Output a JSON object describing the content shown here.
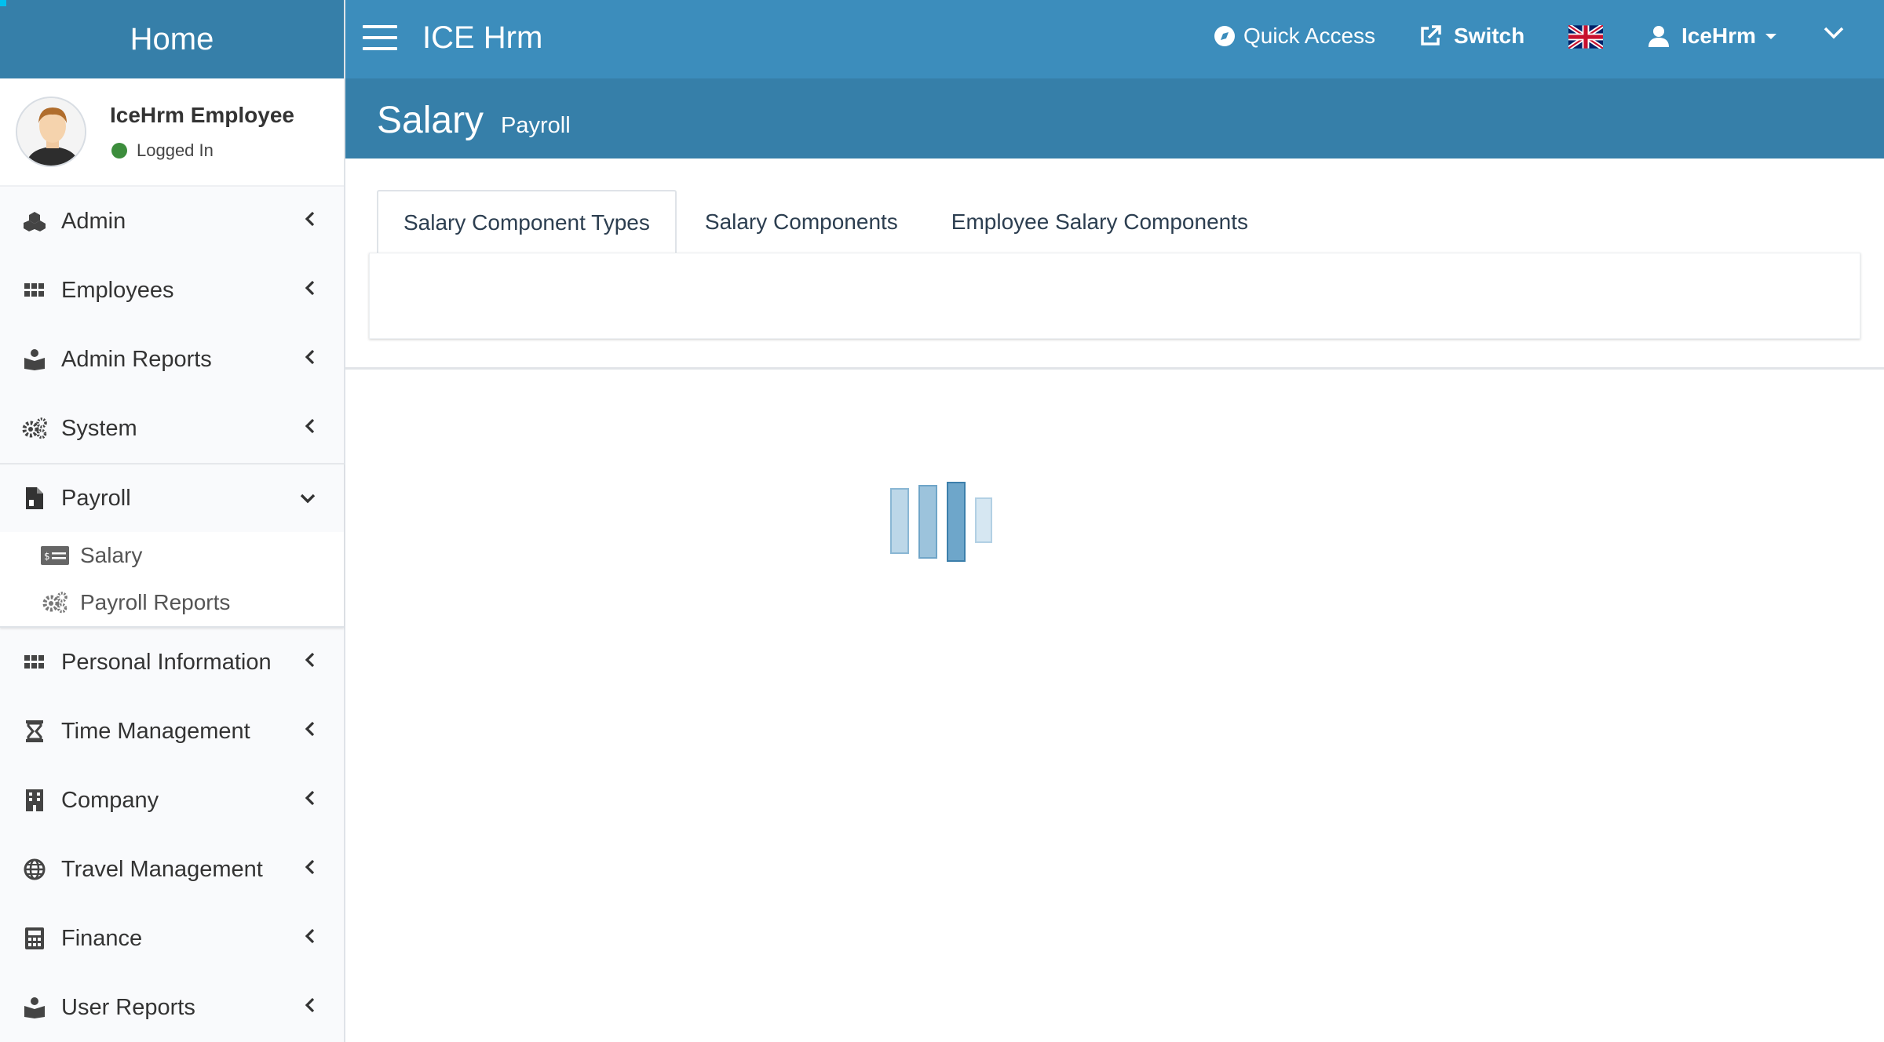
{
  "sidebar": {
    "brand": "Home",
    "user": {
      "name": "IceHrm Employee",
      "status": "Logged In"
    },
    "items": [
      {
        "label": "Admin",
        "icon": "cubes-icon"
      },
      {
        "label": "Employees",
        "icon": "grid-icon"
      },
      {
        "label": "Admin Reports",
        "icon": "book-reader-icon"
      },
      {
        "label": "System",
        "icon": "cogs-icon"
      },
      {
        "label": "Payroll",
        "icon": "file-invoice-icon",
        "expanded": true
      },
      {
        "label": "Personal Information",
        "icon": "grid-icon"
      },
      {
        "label": "Time Management",
        "icon": "hourglass-icon"
      },
      {
        "label": "Company",
        "icon": "building-icon"
      },
      {
        "label": "Travel Management",
        "icon": "globe-icon"
      },
      {
        "label": "Finance",
        "icon": "calculator-icon"
      },
      {
        "label": "User Reports",
        "icon": "book-reader-icon"
      }
    ],
    "payroll_sub": [
      {
        "label": "Salary",
        "icon": "money-check-icon"
      },
      {
        "label": "Payroll Reports",
        "icon": "cogs-icon"
      }
    ]
  },
  "topbar": {
    "app_title": "ICE Hrm",
    "quick_access": "Quick Access",
    "switch": "Switch",
    "user": "IceHrm"
  },
  "header": {
    "title": "Salary",
    "subtitle": "Payroll"
  },
  "tabs": [
    {
      "label": "Salary Component Types",
      "active": true
    },
    {
      "label": "Salary Components",
      "active": false
    },
    {
      "label": "Employee Salary Components",
      "active": false
    }
  ],
  "colors": {
    "topbar": "#3c8dbc",
    "header": "#367fa9",
    "status_online": "#3c8d3c"
  }
}
